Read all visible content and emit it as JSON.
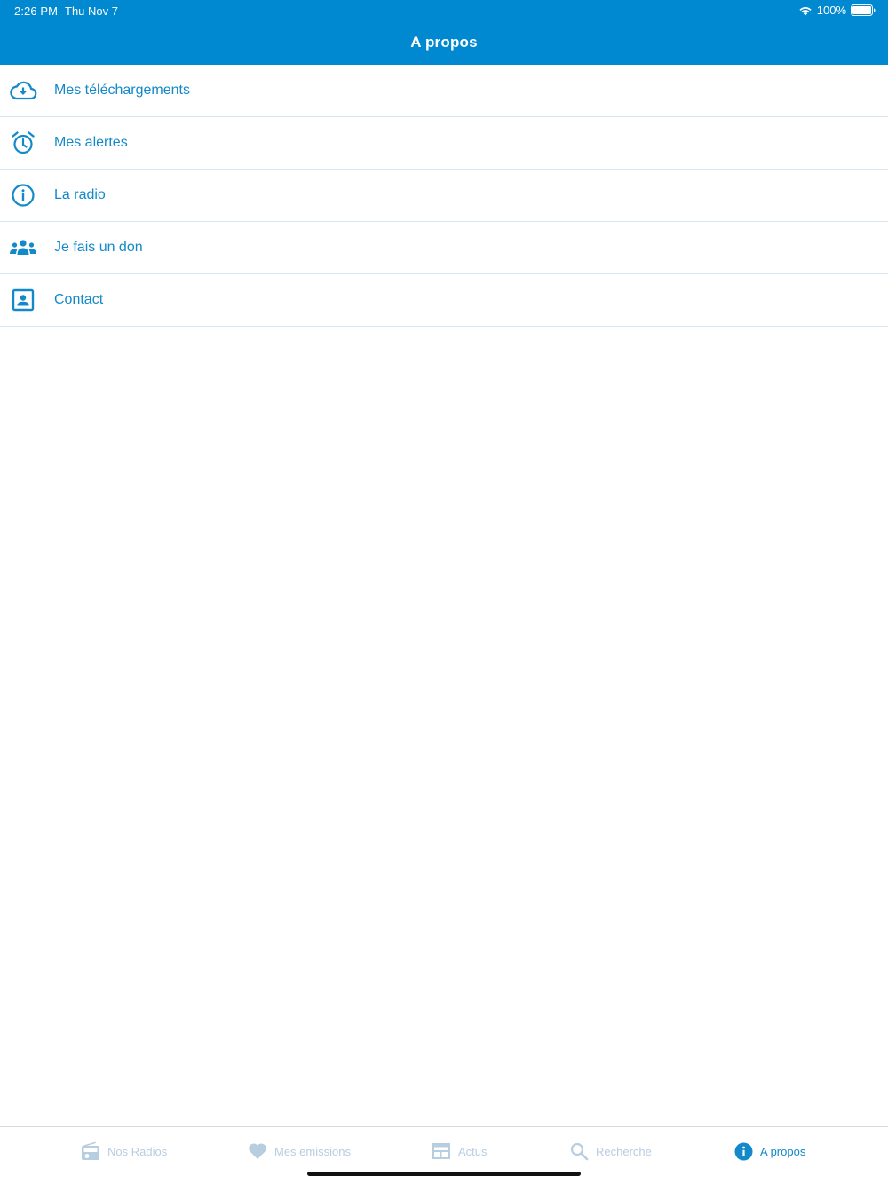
{
  "status_bar": {
    "time": "2:26 PM",
    "date": "Thu Nov 7",
    "battery": "100%"
  },
  "nav": {
    "title": "A propos"
  },
  "colors": {
    "accent": "#0089d0",
    "link": "#1389c9",
    "inactive_tab": "#b7cde0"
  },
  "menu": {
    "items": [
      {
        "label": "Mes téléchargements",
        "icon": "cloud-download-icon"
      },
      {
        "label": "Mes alertes",
        "icon": "alarm-clock-icon"
      },
      {
        "label": "La radio",
        "icon": "info-icon"
      },
      {
        "label": "Je fais un don",
        "icon": "people-group-icon"
      },
      {
        "label": "Contact",
        "icon": "contact-card-icon"
      }
    ]
  },
  "tabs": [
    {
      "label": "Nos Radios",
      "icon": "radio-icon",
      "active": false
    },
    {
      "label": "Mes emissions",
      "icon": "heart-icon",
      "active": false
    },
    {
      "label": "Actus",
      "icon": "news-icon",
      "active": false
    },
    {
      "label": "Recherche",
      "icon": "search-icon",
      "active": false
    },
    {
      "label": "A propos",
      "icon": "info-icon",
      "active": true
    }
  ]
}
